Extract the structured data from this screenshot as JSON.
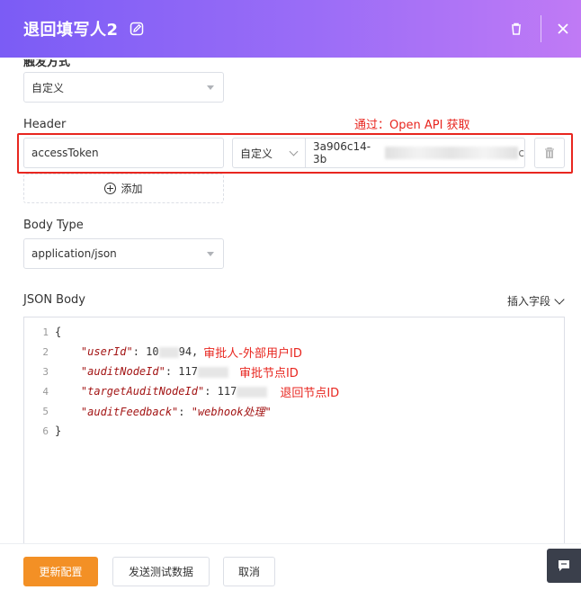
{
  "dialog": {
    "title": "退回填写人2"
  },
  "trigger": {
    "section_label": "触发方式",
    "select_value": "自定义"
  },
  "header_section": {
    "label": "Header",
    "annotation": "通过：Open API 获取",
    "key_value": "accessToken",
    "type_value": "自定义",
    "value_prefix": "3a906c14-3b",
    "value_suffix": "c",
    "add_label": "添加"
  },
  "body_type": {
    "label": "Body Type",
    "select_value": "application/json"
  },
  "json_body": {
    "label": "JSON Body",
    "insert_field_label": "插入字段",
    "lines": [
      {
        "num": "1",
        "text": "{"
      },
      {
        "num": "2",
        "key": "\"userId\"",
        "value": "10",
        "value_tail": "94,",
        "annotation": "审批人-外部用户ID"
      },
      {
        "num": "3",
        "key": "\"auditNodeId\"",
        "value": "117",
        "annotation": "审批节点ID"
      },
      {
        "num": "4",
        "key": "\"targetAuditNodeId\"",
        "value": "117",
        "annotation": "退回节点ID"
      },
      {
        "num": "5",
        "key": "\"auditFeedback\"",
        "value": "\"webhook处理\""
      },
      {
        "num": "6",
        "text": "}"
      }
    ]
  },
  "footer": {
    "update_label": "更新配置",
    "send_test_label": "发送测试数据",
    "cancel_label": "取消"
  },
  "colors": {
    "accent": "#f39025",
    "header_gradient_start": "#7b5cf5",
    "header_gradient_end": "#c07af5",
    "annotation_red": "#e8261f"
  }
}
